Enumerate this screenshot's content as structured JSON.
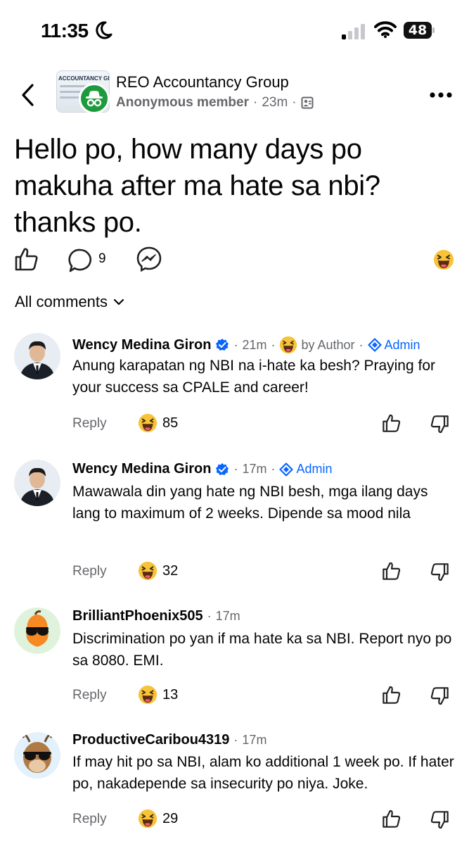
{
  "status_bar": {
    "time": "11:35",
    "battery": "48"
  },
  "header": {
    "group_name": "REO Accountancy Group",
    "thumb_text": "ACCOUNTANCY GR",
    "author": "Anonymous member",
    "time": "23m"
  },
  "post": {
    "text": "Hello po, how many days po makuha after ma hate sa nbi? thanks po.",
    "comment_count": "9"
  },
  "comments_filter": "All comments",
  "comments": [
    {
      "name": "Wency Medina Giron",
      "time": "21m",
      "author_label": "by Author",
      "badge": "Admin",
      "text": "Anung karapatan ng NBI na i-hate ka besh? Praying for your success sa CPALE and career!",
      "reply": "Reply",
      "reactions": "85"
    },
    {
      "name": "Wency Medina Giron",
      "time": "17m",
      "badge": "Admin",
      "text": "Mawawala din yang hate ng NBI besh, mga ilang days lang to maximum of 2 weeks. Dipende sa mood nila",
      "reply": "Reply",
      "reactions": "32"
    },
    {
      "name": "BrilliantPhoenix505",
      "time": "17m",
      "text": "Discrimination po yan if ma hate ka sa NBI. Report nyo po sa 8080. EMI.",
      "reply": "Reply",
      "reactions": "13"
    },
    {
      "name": "ProductiveCaribou4319",
      "time": "17m",
      "text": "If may hit po sa NBI, alam ko additional 1 week po. If hater po, nakadepende sa insecurity po niya. Joke.",
      "reply": "Reply",
      "reactions": "29"
    }
  ],
  "colors": {
    "accent": "#0866ff",
    "secondary_text": "#65676b",
    "anon_badge": "#1d9a3e"
  },
  "icons": [
    "moon-icon",
    "signal-icon",
    "wifi-icon",
    "back-icon",
    "more-icon",
    "like-icon",
    "comment-icon",
    "messenger-icon",
    "haha-icon",
    "chevron-down-icon",
    "verified-icon",
    "admin-icon",
    "dislike-icon"
  ]
}
